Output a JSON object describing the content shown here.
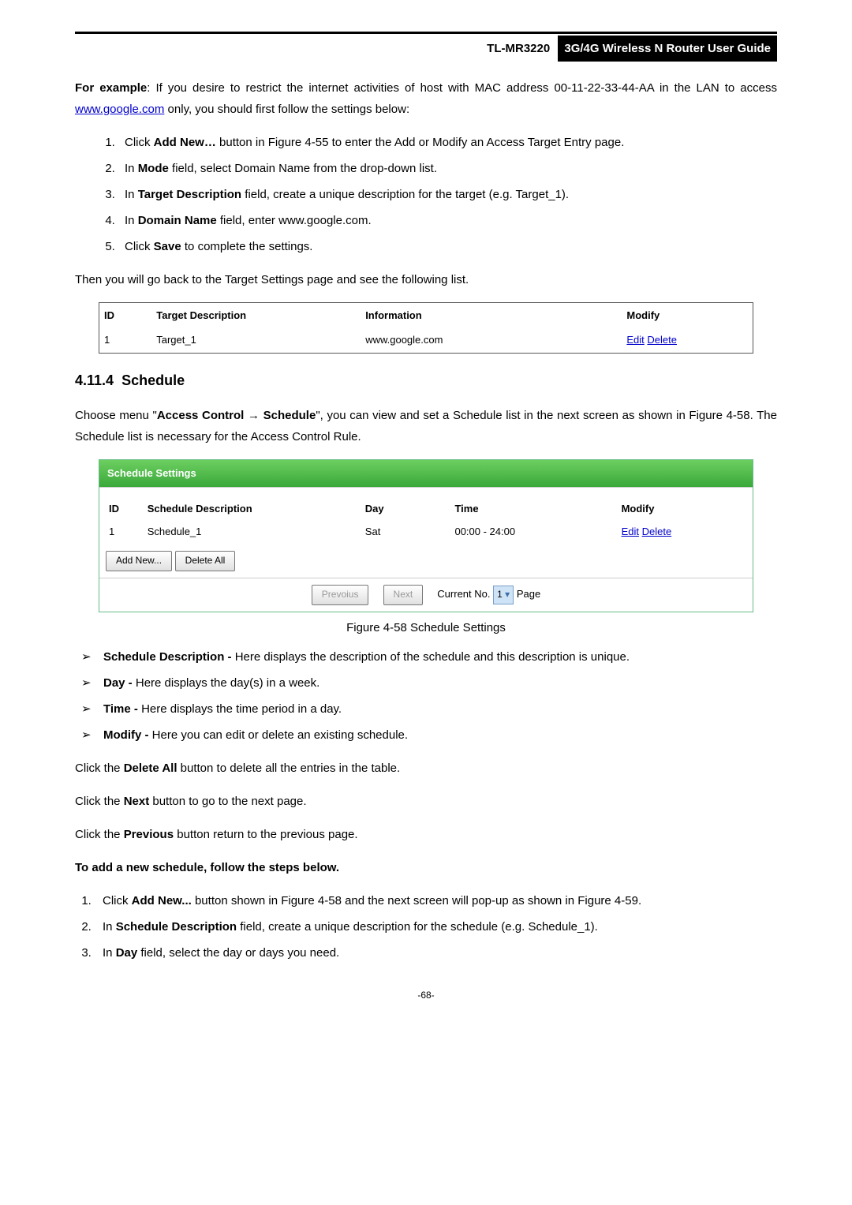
{
  "header": {
    "model": "TL-MR3220",
    "title": "3G/4G Wireless N Router User Guide"
  },
  "intro": {
    "lead": "For example",
    "text1": ": If you desire to restrict the internet activities of host with MAC address 00-11-22-33-44-AA in the LAN to access ",
    "link": "www.google.com",
    "text2": " only, you should first follow the settings below:"
  },
  "steps1": {
    "s1a": "Click ",
    "s1b": "Add New…",
    "s1c": " button in Figure 4-55 to enter the Add or Modify an Access Target Entry page.",
    "s2a": "In ",
    "s2b": "Mode",
    "s2c": " field, select Domain Name from the drop-down list.",
    "s3a": "In ",
    "s3b": "Target Description",
    "s3c": " field, create a unique description for the target (e.g. Target_1).",
    "s4a": "In ",
    "s4b": "Domain Name",
    "s4c": " field, enter www.google.com.",
    "s5a": "Click ",
    "s5b": "Save",
    "s5c": " to complete the settings."
  },
  "then_line": "Then you will go back to the Target Settings page and see the following list.",
  "target_table": {
    "h_id": "ID",
    "h_desc": "Target Description",
    "h_info": "Information",
    "h_mod": "Modify",
    "row": {
      "id": "1",
      "desc": "Target_1",
      "info": "www.google.com",
      "edit": "Edit",
      "delete": "Delete"
    }
  },
  "section": {
    "num": "4.11.4",
    "title": "Schedule"
  },
  "schedule_intro": {
    "p1": "Choose menu \"",
    "b1": "Access Control",
    "arrow": " → ",
    "b2": "Schedule",
    "p2": "\", you can view and set a Schedule list in the next screen as shown in Figure 4-58. The Schedule list is necessary for the Access Control Rule."
  },
  "schedule_panel": {
    "title": "Schedule Settings",
    "h_id": "ID",
    "h_desc": "Schedule Description",
    "h_day": "Day",
    "h_time": "Time",
    "h_mod": "Modify",
    "row": {
      "id": "1",
      "desc": "Schedule_1",
      "day": "Sat",
      "time": "00:00 - 24:00",
      "edit": "Edit",
      "delete": "Delete"
    },
    "btn_add": "Add New...",
    "btn_del": "Delete All",
    "btn_prev": "Prevoius",
    "btn_next": "Next",
    "cur_no_label": "Current No.",
    "cur_no_val": "1",
    "page_label": "Page"
  },
  "fig_caption": "Figure 4-58    Schedule Settings",
  "bullets": {
    "b1a": "Schedule Description -",
    "b1b": " Here displays the description of the schedule and this description is unique.",
    "b2a": "Day -",
    "b2b": " Here displays the day(s) in a week.",
    "b3a": "Time -",
    "b3b": " Here displays the time period in a day.",
    "b4a": "Modify -",
    "b4b": " Here you can edit or delete an existing schedule."
  },
  "click_lines": {
    "l1a": "Click the ",
    "l1b": "Delete All",
    "l1c": " button to delete all the entries in the table.",
    "l2a": "Click the ",
    "l2b": "Next",
    "l2c": " button to go to the next page.",
    "l3a": "Click the ",
    "l3b": "Previous",
    "l3c": " button return to the previous page."
  },
  "add_heading": "To add a new schedule, follow the steps below.",
  "steps2": {
    "s1a": "Click ",
    "s1b": "Add New...",
    "s1c": " button shown in Figure 4-58 and the next screen will pop-up as shown in Figure 4-59.",
    "s2a": "In ",
    "s2b": "Schedule Description",
    "s2c": " field, create a unique description for the schedule (e.g. Schedule_1).",
    "s3a": "In ",
    "s3b": "Day",
    "s3c": " field, select the day or days you need."
  },
  "page_number": "-68-",
  "chart_data": {
    "type": "table",
    "tables": [
      {
        "title": "Target Settings list",
        "columns": [
          "ID",
          "Target Description",
          "Information",
          "Modify"
        ],
        "rows": [
          [
            "1",
            "Target_1",
            "www.google.com",
            "Edit Delete"
          ]
        ]
      },
      {
        "title": "Schedule Settings",
        "columns": [
          "ID",
          "Schedule Description",
          "Day",
          "Time",
          "Modify"
        ],
        "rows": [
          [
            "1",
            "Schedule_1",
            "Sat",
            "00:00 - 24:00",
            "Edit Delete"
          ]
        ]
      }
    ]
  }
}
